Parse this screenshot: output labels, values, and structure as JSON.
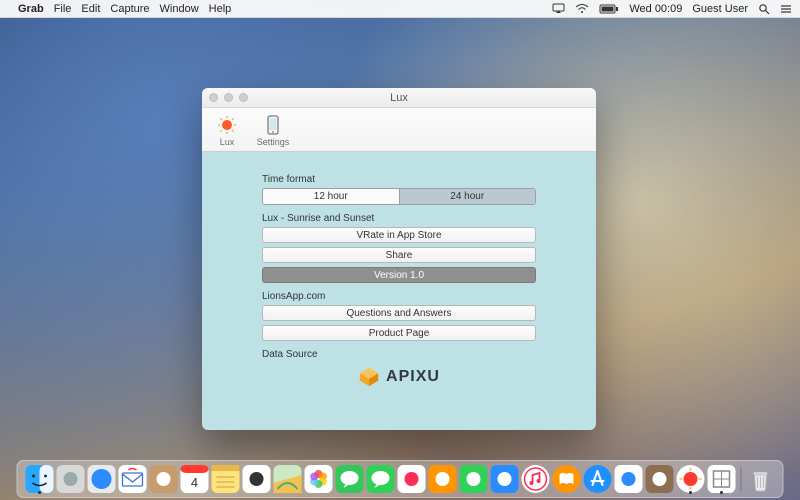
{
  "menubar": {
    "app_name": "Grab",
    "items": [
      "File",
      "Edit",
      "Capture",
      "Window",
      "Help"
    ],
    "status": {
      "time": "Wed 00:09",
      "user": "Guest User"
    }
  },
  "window": {
    "title": "Lux",
    "toolbar": {
      "lux_label": "Lux",
      "settings_label": "Settings"
    },
    "sections": {
      "time_format": {
        "label": "Time format",
        "option_12": "12 hour",
        "option_24": "24 hour",
        "selected": "24"
      },
      "lux": {
        "label": "Lux - Sunrise and Sunset",
        "rate": "VRate in App Store",
        "share": "Share",
        "version": "Version 1.0"
      },
      "lionsapp": {
        "label": "LionsApp.com",
        "qa": "Questions and Answers",
        "product": "Product Page"
      },
      "datasource": {
        "label": "Data Source",
        "brand": "APIXU"
      }
    }
  },
  "dock": {
    "items": [
      {
        "name": "finder",
        "color1": "#2aa6ff",
        "color2": "#ffffff"
      },
      {
        "name": "launchpad",
        "color1": "#d8d8d8",
        "color2": "#9aa"
      },
      {
        "name": "safari",
        "color1": "#2a8cff",
        "color2": "#ffffff"
      },
      {
        "name": "mail",
        "color1": "#ffffff",
        "color2": "#3a75d4"
      },
      {
        "name": "contacts",
        "color1": "#c79b6b",
        "color2": "#ffffff"
      },
      {
        "name": "calendar",
        "color1": "#ffffff",
        "color2": "#ff3b30"
      },
      {
        "name": "notes",
        "color1": "#ffe27a",
        "color2": "#ffffff"
      },
      {
        "name": "reminders",
        "color1": "#ffffff",
        "color2": "#333333"
      },
      {
        "name": "maps",
        "color1": "#cde9c4",
        "color2": "#f5c24d"
      },
      {
        "name": "photos",
        "color1": "#ffffff",
        "color2": "#ff6a00"
      },
      {
        "name": "messages",
        "color1": "#34c759",
        "color2": "#ffffff"
      },
      {
        "name": "facetime",
        "color1": "#30d158",
        "color2": "#ffffff"
      },
      {
        "name": "game-center",
        "color1": "#ffffff",
        "color2": "#ff2d55"
      },
      {
        "name": "pages",
        "color1": "#ff9500",
        "color2": "#ffffff"
      },
      {
        "name": "numbers",
        "color1": "#30d158",
        "color2": "#ffffff"
      },
      {
        "name": "keynote",
        "color1": "#2a8cff",
        "color2": "#ffffff"
      },
      {
        "name": "itunes",
        "color1": "#ffffff",
        "color2": "#ff2d55"
      },
      {
        "name": "ibooks",
        "color1": "#ff9500",
        "color2": "#ffffff"
      },
      {
        "name": "app-store",
        "color1": "#1e90ff",
        "color2": "#ffffff"
      },
      {
        "name": "preview",
        "color1": "#ffffff",
        "color2": "#2a8cff"
      },
      {
        "name": "dictionary",
        "color1": "#8e6e53",
        "color2": "#ffffff"
      },
      {
        "name": "lux-app",
        "color1": "#ffffff",
        "color2": "#ff3b30"
      },
      {
        "name": "grab",
        "color1": "#ffffff",
        "color2": "#888888"
      }
    ],
    "trash": {
      "name": "trash"
    },
    "running": [
      "finder",
      "lux-app",
      "grab"
    ],
    "calendar_day": "4"
  }
}
